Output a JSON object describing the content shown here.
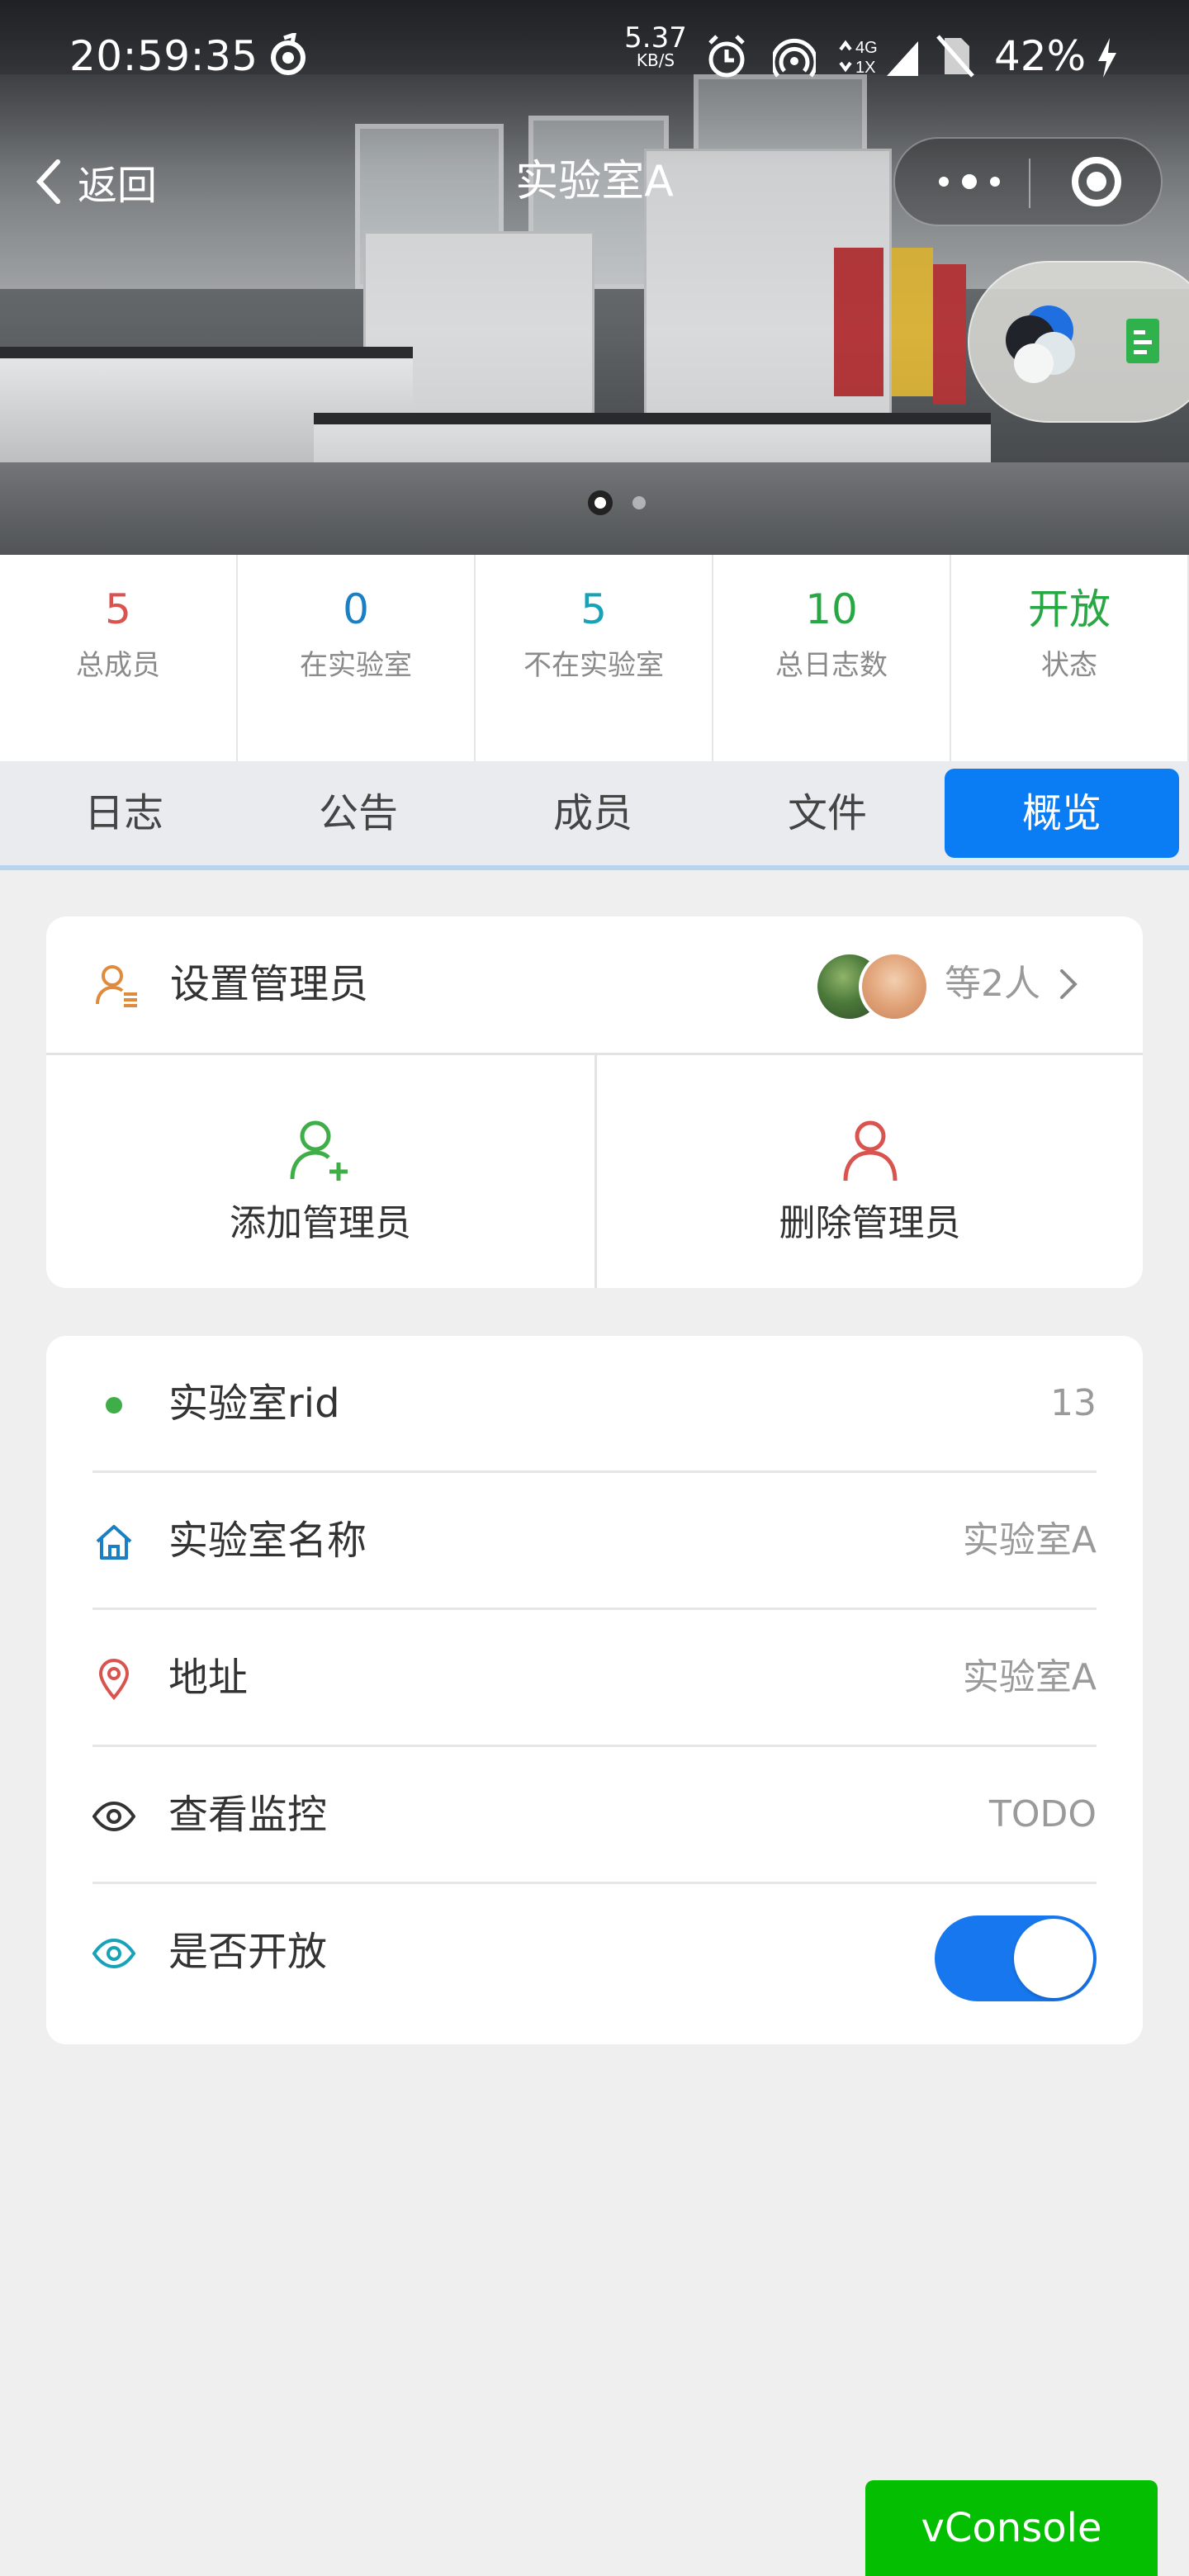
{
  "status_bar": {
    "time": "20:59:35",
    "net_speed": "5.37",
    "net_unit": "KB/S",
    "network_type_top": "4G",
    "network_type_bottom": "1X",
    "battery": "42%"
  },
  "nav": {
    "back_label": "返回",
    "title": "实验室A"
  },
  "carousel": {
    "slide_count": 2,
    "active_index": 0
  },
  "stats": [
    {
      "value": "5",
      "label": "总成员",
      "color": "#d9534f"
    },
    {
      "value": "0",
      "label": "在实验室",
      "color": "#1a7fc3"
    },
    {
      "value": "5",
      "label": "不在实验室",
      "color": "#17a2b8"
    },
    {
      "value": "10",
      "label": "总日志数",
      "color": "#28a745"
    },
    {
      "value": "开放",
      "label": "状态",
      "color": "#28a745"
    }
  ],
  "tabs": [
    {
      "label": "日志",
      "active": false
    },
    {
      "label": "公告",
      "active": false
    },
    {
      "label": "成员",
      "active": false
    },
    {
      "label": "文件",
      "active": false
    },
    {
      "label": "概览",
      "active": true
    }
  ],
  "admin": {
    "title": "设置管理员",
    "count_label": "等2人",
    "add_label": "添加管理员",
    "remove_label": "删除管理员",
    "colors": {
      "icon": "#e08a3c",
      "add": "#3fae49",
      "remove": "#d9534f"
    }
  },
  "info": {
    "rows": [
      {
        "icon": "dot-icon",
        "label": "实验室rid",
        "value": "13"
      },
      {
        "icon": "home-icon",
        "label": "实验室名称",
        "value": "实验室A"
      },
      {
        "icon": "location-pin-icon",
        "label": "地址",
        "value": "实验室A"
      },
      {
        "icon": "eye-icon",
        "label": "查看监控",
        "value": "TODO"
      },
      {
        "icon": "eye-teal-icon",
        "label": "是否开放",
        "toggle_on": true
      }
    ]
  },
  "vconsole_label": "vConsole",
  "accent_color": "#0a7df5"
}
